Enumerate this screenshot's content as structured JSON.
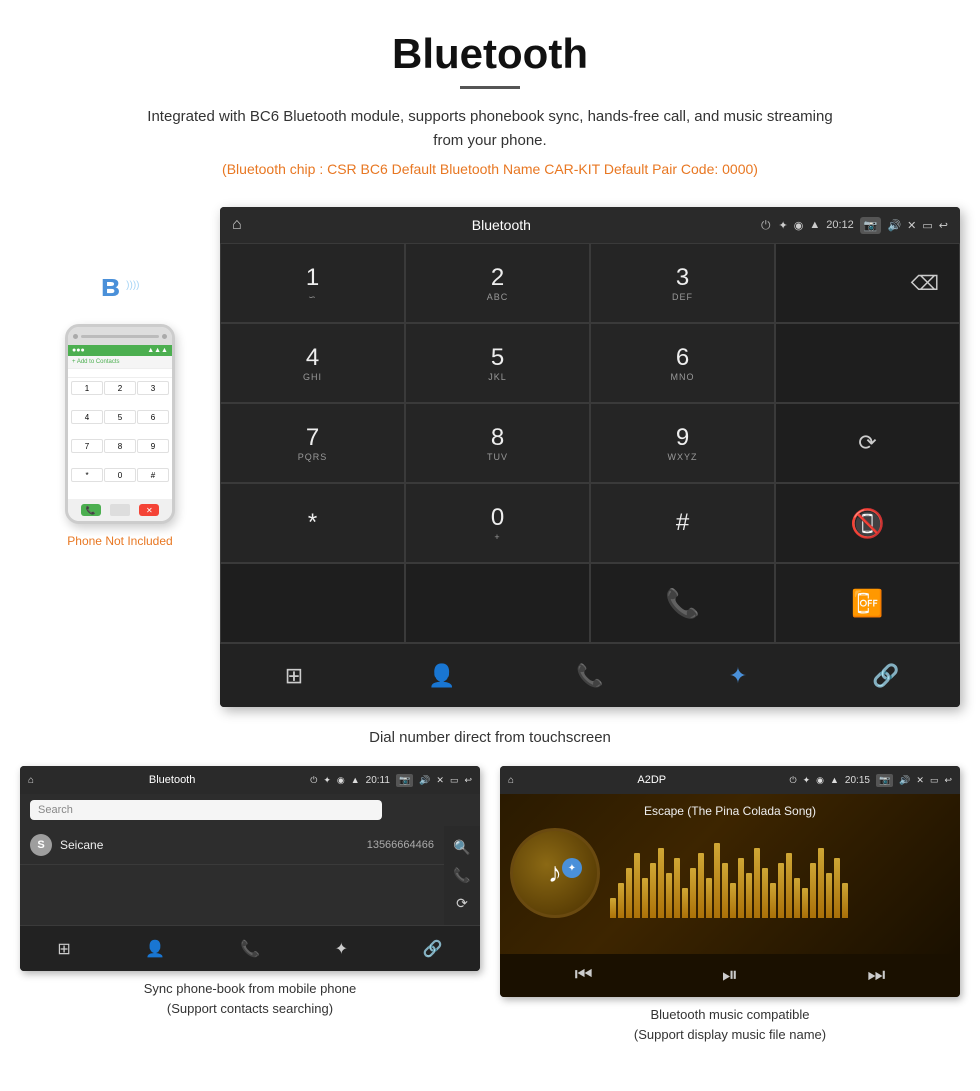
{
  "page": {
    "title": "Bluetooth",
    "description": "Integrated with BC6 Bluetooth module, supports phonebook sync, hands-free call, and music streaming from your phone.",
    "specs": "(Bluetooth chip : CSR BC6    Default Bluetooth Name CAR-KIT    Default Pair Code: 0000)"
  },
  "main_screen": {
    "statusbar": {
      "home_icon": "⌂",
      "title": "Bluetooth",
      "usb_icon": "⏻",
      "bt_icon": "✦",
      "location_icon": "◉",
      "wifi_icon": "▲",
      "time": "20:12",
      "camera_icon": "📷",
      "vol_icon": "🔊",
      "x_icon": "✕",
      "rect_icon": "▭",
      "back_icon": "↩"
    },
    "keys": [
      {
        "main": "1",
        "sub": "∽"
      },
      {
        "main": "2",
        "sub": "ABC"
      },
      {
        "main": "3",
        "sub": "DEF"
      },
      {
        "main": "",
        "sub": "",
        "empty": true
      },
      {
        "main": "4",
        "sub": "GHI"
      },
      {
        "main": "5",
        "sub": "JKL"
      },
      {
        "main": "6",
        "sub": "MNO"
      },
      {
        "main": "",
        "sub": "",
        "empty": true
      },
      {
        "main": "7",
        "sub": "PQRS"
      },
      {
        "main": "8",
        "sub": "TUV"
      },
      {
        "main": "9",
        "sub": "WXYZ"
      },
      {
        "main": "",
        "sub": "",
        "empty": true
      },
      {
        "main": "*",
        "sub": ""
      },
      {
        "main": "0",
        "sub": "+"
      },
      {
        "main": "#",
        "sub": ""
      },
      {
        "main": "",
        "sub": "",
        "empty": true
      }
    ],
    "bottom_nav": {
      "items": [
        "⊞",
        "👤",
        "📞",
        "✦",
        "🔗"
      ]
    },
    "caption": "Dial number direct from touchscreen"
  },
  "phonebook_screen": {
    "statusbar": {
      "home_icon": "⌂",
      "title": "Bluetooth",
      "time": "20:11"
    },
    "search_placeholder": "Search",
    "contact": {
      "letter": "S",
      "name": "Seicane",
      "number": "13566664466"
    },
    "caption": "Sync phone-book from mobile phone\n(Support contacts searching)"
  },
  "music_screen": {
    "statusbar": {
      "home_icon": "⌂",
      "title": "A2DP",
      "time": "20:15"
    },
    "song_title": "Escape (The Pina Colada Song)",
    "visualizer_bars": [
      20,
      35,
      50,
      65,
      40,
      55,
      70,
      45,
      60,
      30,
      50,
      65,
      40,
      75,
      55,
      35,
      60,
      45,
      70,
      50,
      35,
      55,
      65,
      40,
      30,
      55,
      70,
      45,
      60,
      35
    ],
    "controls": {
      "prev": "⏮",
      "play_pause": "⏯",
      "next": "⏭"
    },
    "caption": "Bluetooth music compatible\n(Support display music file name)"
  },
  "phone_illustration": {
    "not_included_label": "Phone Not Included"
  }
}
